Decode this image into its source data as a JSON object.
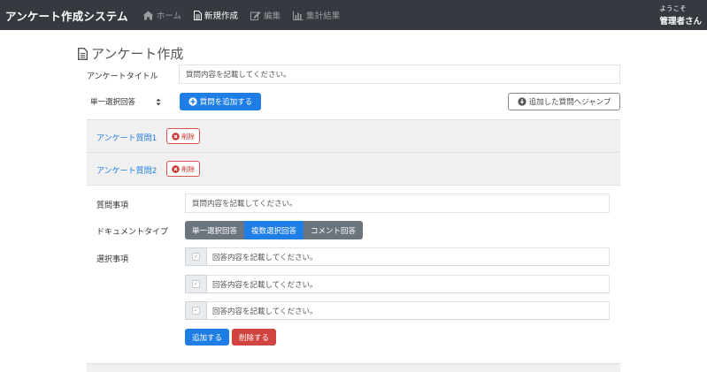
{
  "nav": {
    "brand": "アンケート作成システム",
    "items": [
      {
        "label": "ホーム",
        "icon": "home-icon",
        "active": false
      },
      {
        "label": "新規作成",
        "icon": "document-icon",
        "active": true
      },
      {
        "label": "編集",
        "icon": "edit-icon",
        "active": false
      },
      {
        "label": "集計結果",
        "icon": "chart-icon",
        "active": false
      }
    ],
    "greeting_line1": "ようこそ",
    "greeting_line2": "管理者さん"
  },
  "page": {
    "title": "アンケート作成"
  },
  "form": {
    "title_label": "アンケートタイトル",
    "title_placeholder": "質問内容を記載してください。",
    "type_select_value": "単一選択回答",
    "add_question_label": "質問を追加する",
    "jump_label": "追加した質問へジャンプ"
  },
  "questions": [
    {
      "label": "アンケート質問1",
      "delete_label": "削除"
    },
    {
      "label": "アンケート質問2",
      "delete_label": "削除"
    }
  ],
  "detail": {
    "question_label": "質問事項",
    "question_placeholder": "質問内容を記載してください。",
    "doc_type_label": "ドキュメントタイプ",
    "doc_types": [
      "単一選択回答",
      "複数選択回答",
      "コメント回答"
    ],
    "doc_type_selected": "複数選択回答",
    "choices_label": "選択事項",
    "choices": [
      {
        "placeholder": "回答内容を記載してください。",
        "checked": true
      },
      {
        "placeholder": "回答内容を記載してください。",
        "checked": true
      },
      {
        "placeholder": "回答内容を記載してください。",
        "checked": true
      }
    ],
    "add_label": "追加する",
    "delete_label": "削除する"
  },
  "colors": {
    "navbar": "#343a40",
    "primary": "#1e7ee6",
    "secondary": "#6c757d",
    "danger": "#d0433e"
  }
}
